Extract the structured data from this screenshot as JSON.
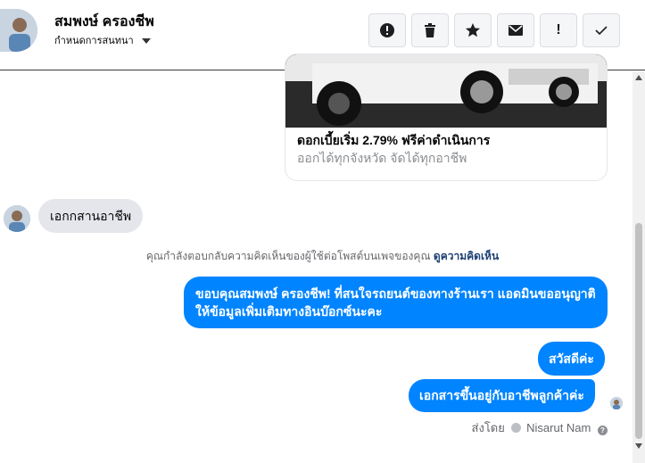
{
  "header": {
    "name": "สมพงษ์ ครองชีพ",
    "subtitle": "กำหนดการสนทนา"
  },
  "toolbar": [
    {
      "icon": "alert-circle-icon"
    },
    {
      "icon": "trash-icon"
    },
    {
      "icon": "star-icon"
    },
    {
      "icon": "envelope-icon"
    },
    {
      "icon": "exclamation-icon",
      "glyph": "!"
    },
    {
      "icon": "checkmark-icon"
    }
  ],
  "card": {
    "title": "ดอกเบี้ยเริ่ม 2.79% ฟรีค่าดำเนินการ",
    "subtitle": "ออกได้ทุกจังหวัด จัดได้ทุกอาชีพ"
  },
  "messages": {
    "incoming_1": "เอกกสานอาชีพ",
    "notice_text": "คุณกำลังตอบกลับความคิดเห็นของผู้ใช้ต่อโพสต์บนเพจของคุณ",
    "notice_link": "ดูความคิดเห็น",
    "outgoing_1": "ขอบคุณสมพงษ์ ครองชีพ! ที่สนใจรถยนต์ของทางร้านเรา แอดมินขออนุญาติ ให้ข้อมูลเพิ่มเติมทางอินบ๊อกซ์นะคะ",
    "outgoing_2": "สวัสดีค่ะ",
    "outgoing_3": "เอกสารขึ้นอยู่กับอาชีพลูกค้าค่ะ"
  },
  "footer": {
    "sent_by_label": "ส่งโดย",
    "sender": "Nisarut Nam"
  },
  "colors": {
    "accent": "#0084ff",
    "incoming_bubble": "#e4e6eb",
    "notice_link": "#1c3f73"
  }
}
